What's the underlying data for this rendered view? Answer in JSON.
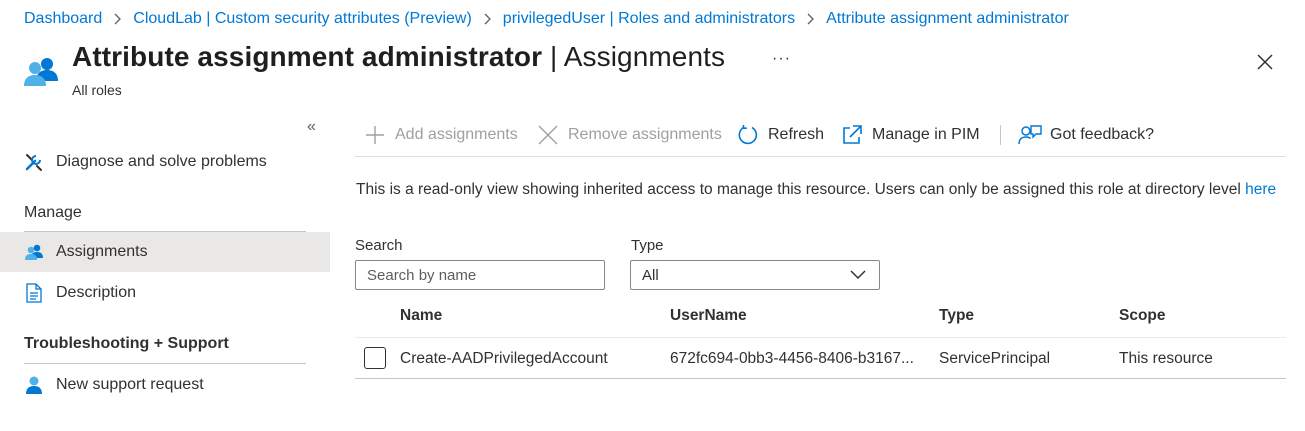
{
  "breadcrumb": {
    "items": [
      "Dashboard",
      "CloudLab | Custom security attributes (Preview)",
      "privilegedUser | Roles and administrators",
      "Attribute assignment administrator"
    ]
  },
  "header": {
    "title_bold": "Attribute assignment administrator",
    "title_rest": " | Assignments",
    "subtitle": "All roles",
    "more_label": "···",
    "icon": "users-role-icon"
  },
  "sidebar": {
    "collapse_label": "«",
    "diagnose_label": "Diagnose and solve problems",
    "manage_header": "Manage",
    "assignments_label": "Assignments",
    "description_label": "Description",
    "troubleshooting_header": "Troubleshooting + Support",
    "support_label": "New support request"
  },
  "toolbar": {
    "add_label": "Add assignments",
    "remove_label": "Remove assignments",
    "refresh_label": "Refresh",
    "pim_label": "Manage in PIM",
    "feedback_label": "Got feedback?"
  },
  "info": {
    "text": "This is a read-only view showing inherited access to manage this resource. Users can only be assigned this role at directory level ",
    "link": "here"
  },
  "filters": {
    "search_label": "Search",
    "search_placeholder": "Search by name",
    "type_label": "Type",
    "type_value": "All"
  },
  "table": {
    "headers": [
      "Name",
      "UserName",
      "Type",
      "Scope"
    ],
    "rows": [
      {
        "name": "Create-AADPrivilegedAccount",
        "username": "672fc694-0bb3-4456-8406-b3167...",
        "type": "ServicePrincipal",
        "scope": "This resource"
      }
    ]
  },
  "colors": {
    "accent": "#0078d4",
    "text": "#323130",
    "disabled": "#a19f9d",
    "selected_bg": "#e9e8e7"
  }
}
